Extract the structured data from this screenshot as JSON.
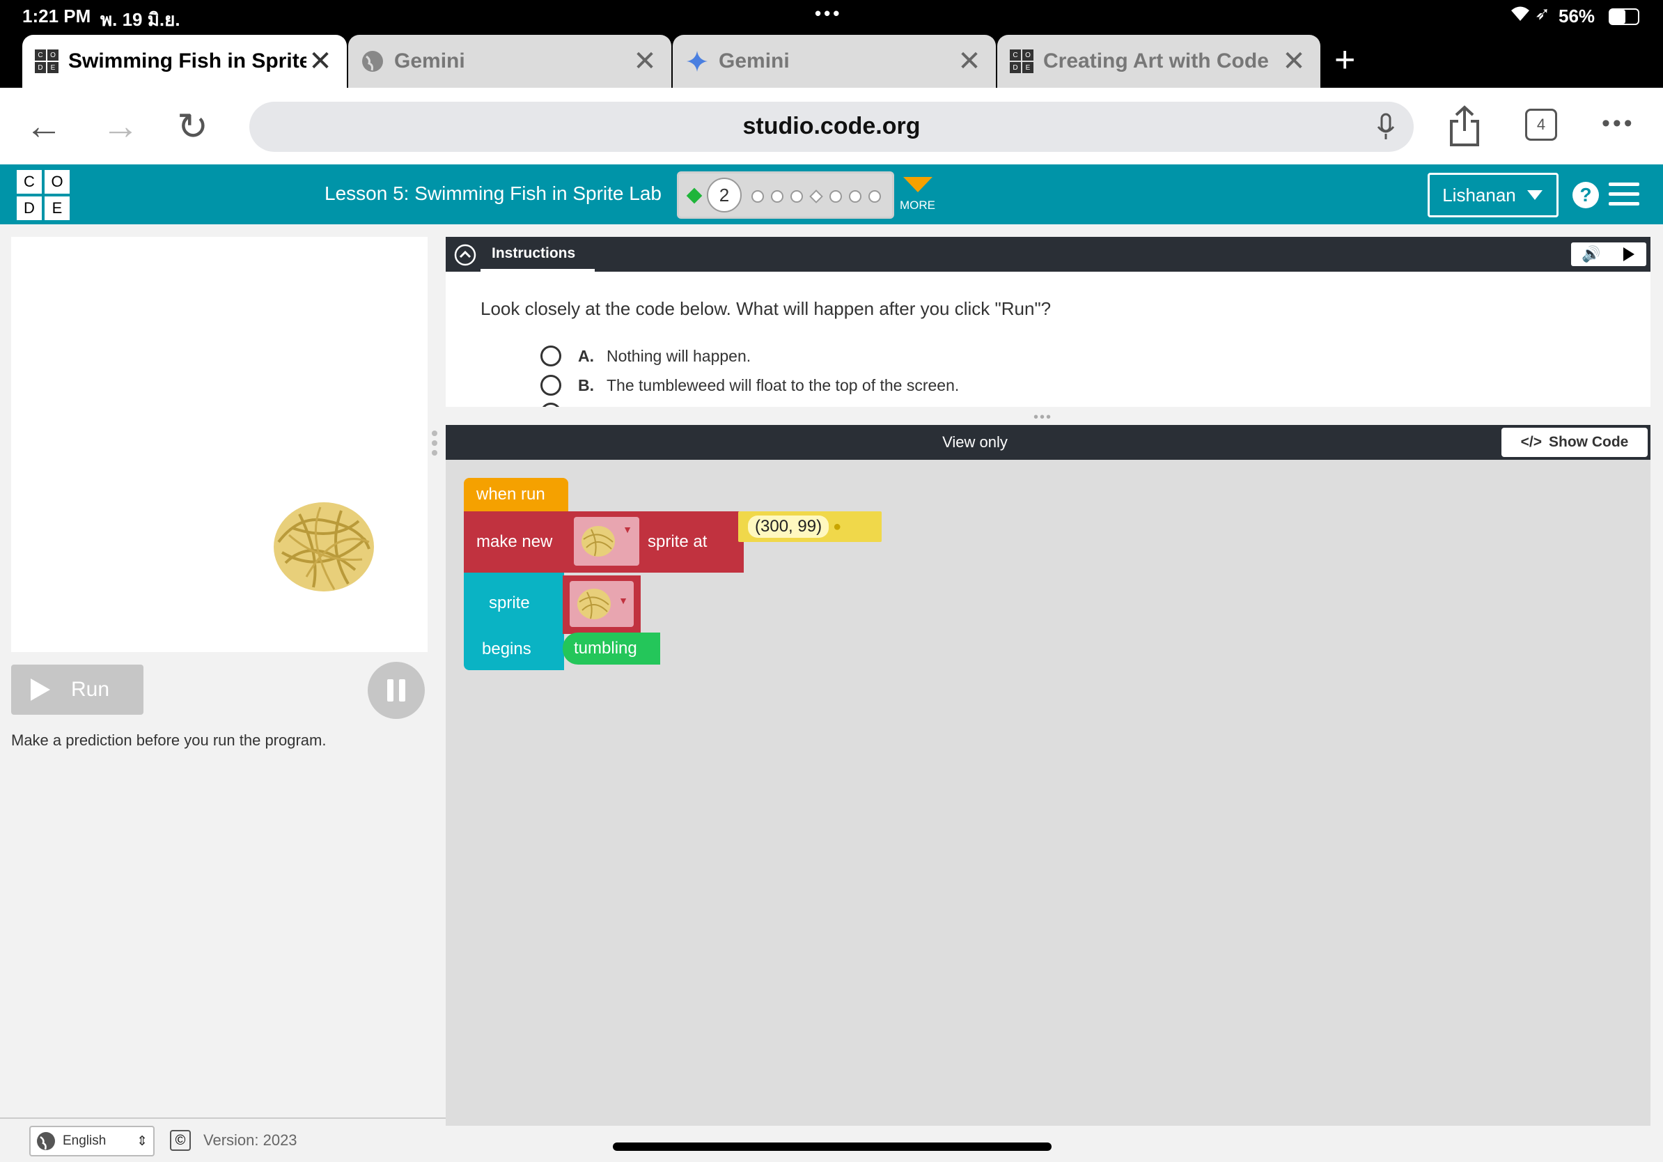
{
  "status_bar": {
    "time": "1:21 PM",
    "date": "พ. 19 มิ.ย.",
    "battery": "56%"
  },
  "browser": {
    "tabs": [
      {
        "title": "Swimming Fish in Sprite",
        "icon": "code-org-icon",
        "active": true
      },
      {
        "title": "Gemini",
        "icon": "globe-icon",
        "active": false
      },
      {
        "title": "Gemini",
        "icon": "gemini-sparkle-icon",
        "active": false
      },
      {
        "title": "Creating Art with Code",
        "icon": "code-org-icon",
        "active": false
      }
    ],
    "url": "studio.code.org",
    "tab_count": "4"
  },
  "header": {
    "logo_letters": [
      "C",
      "O",
      "D",
      "E"
    ],
    "lesson_title": "Lesson 5: Swimming Fish in Sprite Lab",
    "current_level": "2",
    "more_label": "MORE",
    "user_name": "Lishanan",
    "help_label": "?",
    "accent_color": "#0094a8"
  },
  "stage": {
    "run_label": "Run",
    "hint": "Make a prediction before you run the program."
  },
  "instructions": {
    "tab_label": "Instructions",
    "question": "Look closely at the code below. What will happen after you click \"Run\"?",
    "options": [
      {
        "letter": "A.",
        "text": "Nothing will happen."
      },
      {
        "letter": "B.",
        "text": "The tumbleweed will float to the top of the screen."
      }
    ]
  },
  "workspace": {
    "view_only_label": "View only",
    "show_code_label": "Show Code",
    "blocks": {
      "when_run": "when run",
      "make_new": "make new",
      "sprite_at": "sprite at",
      "location": "(300, 99)",
      "sprite": "sprite",
      "begins": "begins",
      "behavior": "tumbling"
    },
    "colors": {
      "event": "#f5a100",
      "sprite": "#c1323f",
      "behavior": "#0ab3c4",
      "location": "#f0d84a",
      "green": "#24c65a"
    }
  },
  "footer": {
    "language": "English",
    "version": "Version: 2023"
  }
}
